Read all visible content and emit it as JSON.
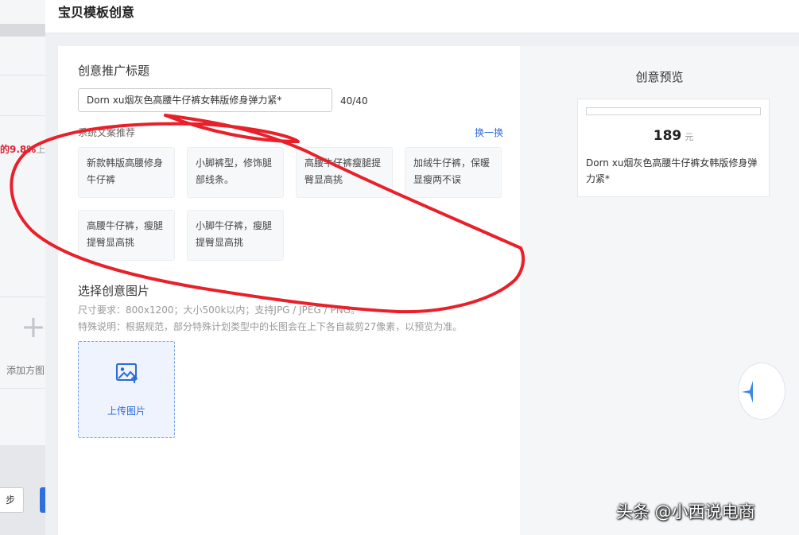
{
  "background": {
    "percent_text": "的9.8%",
    "percent_tail": "上",
    "add_image_label": "添加方图",
    "prev_button_label": "步"
  },
  "modal": {
    "title": "宝贝模板创意",
    "creative_title_section": "创意推广标题",
    "title_input_value": "Dorn xu烟灰色高腰牛仔裤女韩版修身弹力紧*",
    "char_count": "40/40",
    "recommend_label": "系统文案推荐",
    "swap_label": "换一换",
    "suggestions": [
      {
        "line1": "新款韩版高腰修身",
        "line2": "牛仔裤"
      },
      {
        "line1": "小脚裤型，修饰腿",
        "line2": "部线条。"
      },
      {
        "line1": "高腰牛仔裤瘦腿提",
        "line2": "臀显高挑"
      },
      {
        "line1": "加绒牛仔裤，保暖",
        "line2": "显瘦两不误"
      },
      {
        "line1": "高腰牛仔裤，瘦腿",
        "line2": "提臀显高挑"
      },
      {
        "line1": "小脚牛仔裤，瘦腿",
        "line2": "提臀显高挑"
      }
    ],
    "image_section": "选择创意图片",
    "size_hint": "尺寸要求：800x1200；大小500k以内；支持JPG / JPEG / PNG。",
    "special_hint": "特殊说明：根据规范，部分特殊计划类型中的长图会在上下各自裁剪27像素，以预览为准。",
    "upload_label": "上传图片",
    "upload_icon": "image-upload-icon"
  },
  "preview": {
    "title": "创意预览",
    "price": "189",
    "unit": "元",
    "text": "Dorn xu烟灰色高腰牛仔裤女韩版修身弹力紧*"
  },
  "watermark": "头条 @小西说电商",
  "colors": {
    "accent": "#2a6ad9",
    "annotation": "#e8202a"
  }
}
